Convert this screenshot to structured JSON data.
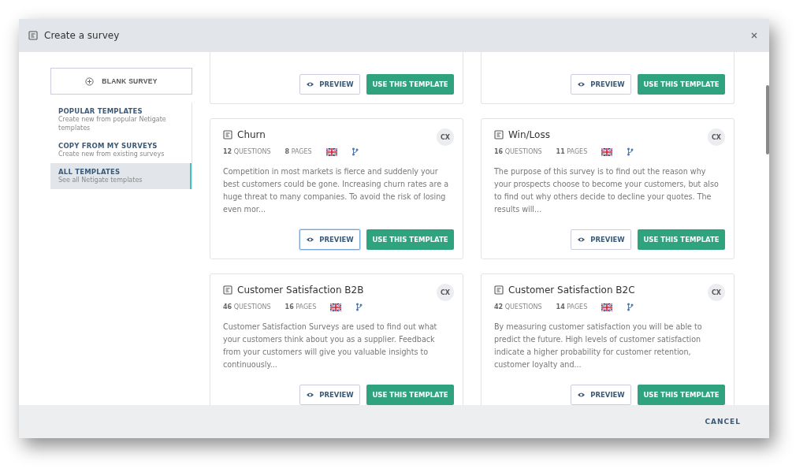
{
  "window": {
    "title": "Create a survey"
  },
  "blank_button": {
    "label": "BLANK SURVEY"
  },
  "sidebar": {
    "items": [
      {
        "title": "POPULAR TEMPLATES",
        "subtitle": "Create new from popular Netigate templates",
        "selected": false
      },
      {
        "title": "COPY FROM MY SURVEYS",
        "subtitle": "Create new from existing surveys",
        "selected": false
      },
      {
        "title": "ALL TEMPLATES",
        "subtitle": "See all Netigate templates",
        "selected": true
      }
    ]
  },
  "cards": [
    {
      "kind": "partial",
      "preview": {
        "label": "PREVIEW",
        "focused": false
      },
      "use": {
        "label": "USE THIS TEMPLATE"
      }
    },
    {
      "kind": "partial",
      "preview": {
        "label": "PREVIEW",
        "focused": false
      },
      "use": {
        "label": "USE THIS TEMPLATE"
      }
    },
    {
      "kind": "full",
      "title": "Churn",
      "badge": "CX",
      "questions": "12",
      "questions_label": "QUESTIONS",
      "pages": "8",
      "pages_label": "PAGES",
      "description": "Competition in most markets is fierce and suddenly your best customers could be gone. Increasing churn rates are a huge threat to many companies. To avoid the risk of losing even mor...",
      "preview": {
        "label": "PREVIEW",
        "focused": true
      },
      "use": {
        "label": "USE THIS TEMPLATE"
      }
    },
    {
      "kind": "full",
      "title": "Win/Loss",
      "badge": "CX",
      "questions": "16",
      "questions_label": "QUESTIONS",
      "pages": "11",
      "pages_label": "PAGES",
      "description": "The purpose of this survey is to find out the reason why your prospects choose to become your customers, but also to find out why others decide to decline your quotes. The results will...",
      "preview": {
        "label": "PREVIEW",
        "focused": false
      },
      "use": {
        "label": "USE THIS TEMPLATE"
      }
    },
    {
      "kind": "full",
      "title": "Customer Satisfaction B2B",
      "badge": "CX",
      "questions": "46",
      "questions_label": "QUESTIONS",
      "pages": "16",
      "pages_label": "PAGES",
      "description": "Customer Satisfaction Surveys are used to find out what your customers think about you as a supplier. Feedback from your customers will give you valuable insights to continuously...",
      "preview": {
        "label": "PREVIEW",
        "focused": false
      },
      "use": {
        "label": "USE THIS TEMPLATE"
      }
    },
    {
      "kind": "full",
      "title": "Customer Satisfaction B2C",
      "badge": "CX",
      "questions": "42",
      "questions_label": "QUESTIONS",
      "pages": "14",
      "pages_label": "PAGES",
      "description": "By measuring customer satisfaction you will be able to predict the future. High levels of customer satisfaction indicate a higher probability for customer retention, customer loyalty and...",
      "preview": {
        "label": "PREVIEW",
        "focused": false
      },
      "use": {
        "label": "USE THIS TEMPLATE"
      }
    }
  ],
  "footer": {
    "cancel": "CANCEL"
  }
}
